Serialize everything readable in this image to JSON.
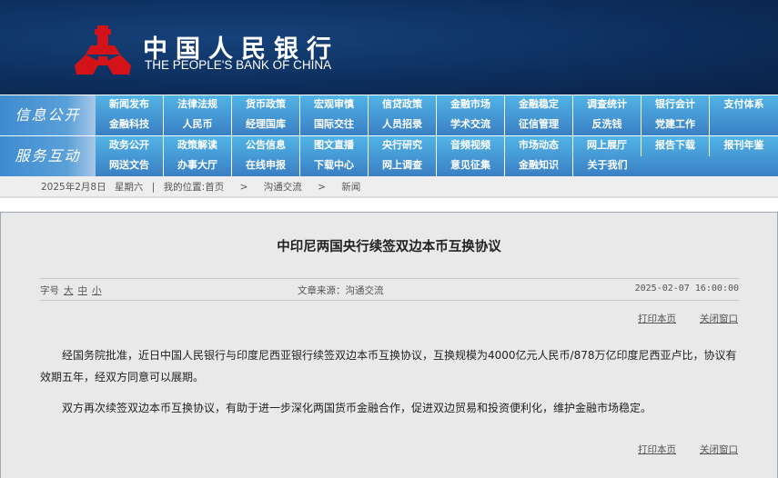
{
  "header": {
    "logo_cn": "中国人民银行",
    "logo_en": "THE PEOPLE'S BANK OF CHINA",
    "brand_red": "#d4121a",
    "bg": "#0d2f5e"
  },
  "nav": [
    {
      "label": "信息公开",
      "rows": [
        [
          "新闻发布",
          "法律法规",
          "货币政策",
          "宏观审慎",
          "信贷政策",
          "金融市场",
          "金融稳定",
          "调查统计",
          "银行会计",
          "支付体系"
        ],
        [
          "金融科技",
          "人民币",
          "经理国库",
          "国际交往",
          "人员招录",
          "学术交流",
          "征信管理",
          "反洗钱",
          "党建工作"
        ]
      ]
    },
    {
      "label": "服务互动",
      "rows": [
        [
          "政务公开",
          "政策解读",
          "公告信息",
          "图文直播",
          "央行研究",
          "音频视频",
          "市场动态",
          "网上展厅",
          "报告下载",
          "报刊年鉴"
        ],
        [
          "网送文告",
          "办事大厅",
          "在线申报",
          "下载中心",
          "网上调查",
          "意见征集",
          "金融知识",
          "关于我们"
        ]
      ]
    }
  ],
  "breadcrumb": {
    "date": "2025年2月8日",
    "weekday": "星期六",
    "sep": "|",
    "location_label": "我的位置:",
    "items": [
      "首页",
      "沟通交流",
      "新闻"
    ],
    "arrow": ">"
  },
  "article": {
    "title": "中印尼两国央行续签双边本币互换协议",
    "fontsize_label": "字号",
    "fontsize_options": [
      "大",
      "中",
      "小"
    ],
    "source": "文章来源：沟通交流",
    "datetime": "2025-02-07  16:00:00",
    "print_label": "打印本页",
    "close_label": "关闭窗口",
    "paragraphs": [
      "经国务院批准，近日中国人民银行与印度尼西亚银行续签双边本币互换协议，互换规模为4000亿元人民币/878万亿印度尼西亚卢比，协议有效期五年，经双方同意可以展期。",
      "双方再次续签双边本币互换协议，有助于进一步深化两国货币金融合作，促进双边贸易和投资便利化，维护金融市场稳定。"
    ]
  }
}
